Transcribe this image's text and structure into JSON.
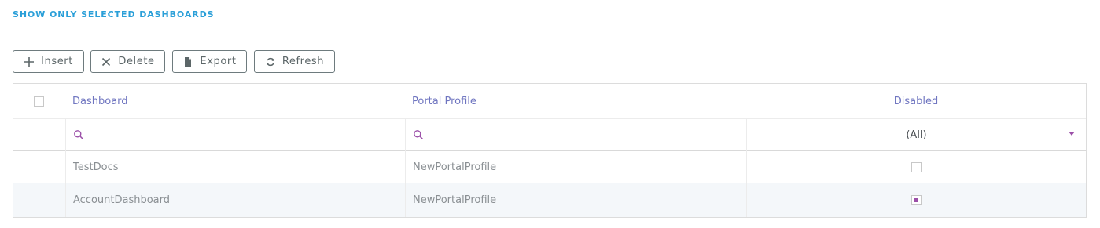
{
  "section": {
    "title": "SHOW ONLY SELECTED DASHBOARDS"
  },
  "toolbar": {
    "insert_label": "Insert",
    "delete_label": "Delete",
    "export_label": "Export",
    "refresh_label": "Refresh"
  },
  "grid": {
    "columns": [
      "Dashboard",
      "Portal Profile",
      "Disabled"
    ],
    "filter": {
      "disabled_value": "(All)"
    },
    "rows": [
      {
        "dashboard": "TestDocs",
        "portal_profile": "NewPortalProfile",
        "disabled": false
      },
      {
        "dashboard": "AccountDashboard",
        "portal_profile": "NewPortalProfile",
        "disabled": true
      }
    ]
  },
  "colors": {
    "accent": "#2a9fd8",
    "header_text": "#6f75c0",
    "filter_accent": "#9b4fa8"
  }
}
